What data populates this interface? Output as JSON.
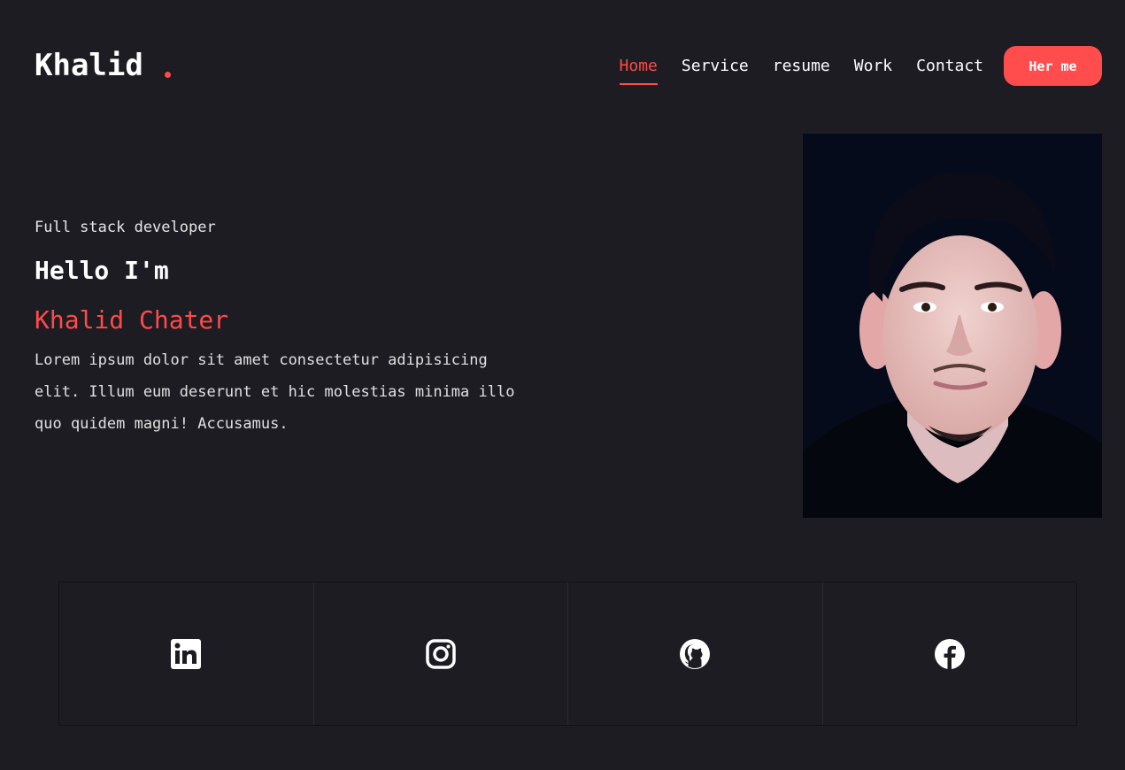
{
  "header": {
    "logo": "Khalid",
    "nav": [
      "Home",
      "Service",
      "resume",
      "Work",
      "Contact"
    ],
    "active_nav": "Home",
    "hire_label": "Her me"
  },
  "hero": {
    "subtitle": "Full stack developer",
    "greeting": "Hello I'm",
    "name": "Khalid Chater",
    "description": "Lorem ipsum dolor sit amet consectetur adipisicing elit. Illum eum deserunt et hic molestias minima illo quo quidem magni! Accusamus.",
    "portrait_icon": "portrait-photo"
  },
  "social": {
    "items": [
      "linkedin-icon",
      "instagram-icon",
      "github-icon",
      "facebook-icon"
    ]
  },
  "colors": {
    "background": "#1d1c22",
    "accent": "#ff4a4a",
    "button": "#ff4d4d",
    "text": "#ffffff",
    "portrait_bg": "#060b1c"
  }
}
